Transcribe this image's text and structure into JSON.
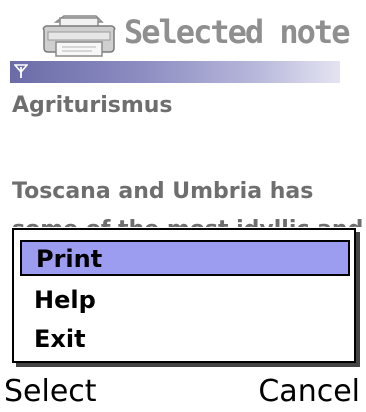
{
  "title_bar": {
    "title": "Selected note",
    "icon": "printer-icon"
  },
  "status_strip": {
    "icon": "signal-antenna-icon",
    "gradient_colors": [
      "#6b6ba8",
      "#e4e4f2"
    ]
  },
  "note": {
    "title": "Agriturismus",
    "body_lines": [
      "Toscana and Umbria has",
      "some of the most idyllic and"
    ]
  },
  "options_menu": {
    "selected_index": 0,
    "highlight_color": "#9c9cf0",
    "items": [
      {
        "label": "Print"
      },
      {
        "label": "Help"
      },
      {
        "label": "Exit"
      }
    ]
  },
  "softkeys": {
    "left": "Select",
    "right": "Cancel"
  }
}
